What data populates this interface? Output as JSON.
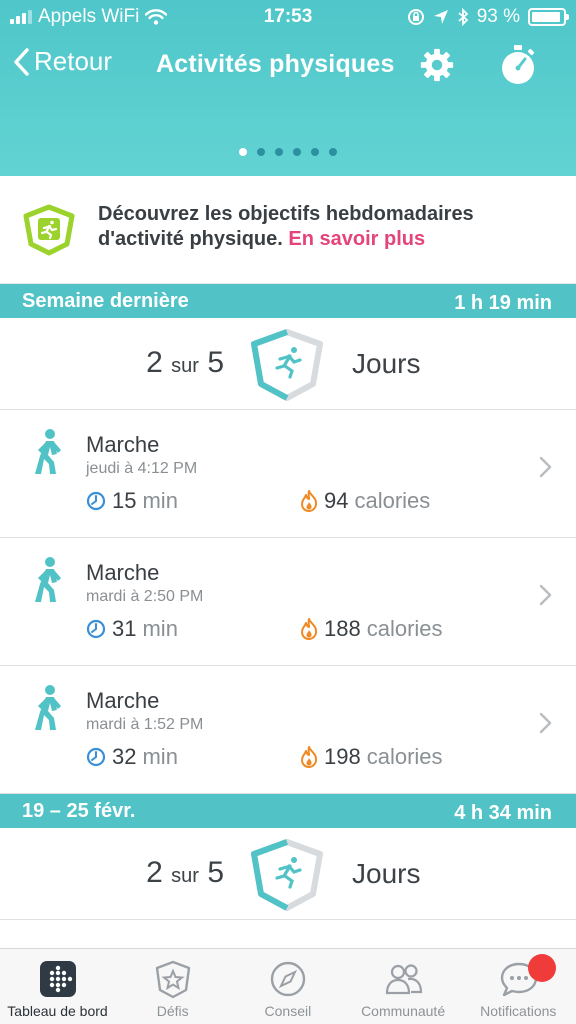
{
  "status_bar": {
    "carrier": "Appels WiFi",
    "time": "17:53",
    "battery_percent": "93 %",
    "battery_level": 0.93
  },
  "header": {
    "back_label": "Retour",
    "title": "Activités physiques",
    "page_count": 6,
    "active_page": 0
  },
  "promo": {
    "text": "Découvrez les objectifs hebdomadaires d'activité physique.",
    "link": "En savoir plus"
  },
  "weeks": [
    {
      "label": "Semaine dernière",
      "total": "1 h 19 min",
      "goal": {
        "count": "2",
        "of": "sur",
        "target": "5",
        "unit": "Jours"
      },
      "activities": [
        {
          "name": "Marche",
          "time": "jeudi à 4:12 PM",
          "duration": "15",
          "duration_unit": "min",
          "calories": "94",
          "calories_unit": "calories"
        },
        {
          "name": "Marche",
          "time": "mardi à 2:50 PM",
          "duration": "31",
          "duration_unit": "min",
          "calories": "188",
          "calories_unit": "calories"
        },
        {
          "name": "Marche",
          "time": "mardi à 1:52 PM",
          "duration": "32",
          "duration_unit": "min",
          "calories": "198",
          "calories_unit": "calories"
        }
      ]
    },
    {
      "label": "19 – 25 févr.",
      "total": "4 h 34 min",
      "goal": {
        "count": "2",
        "of": "sur",
        "target": "5",
        "unit": "Jours"
      }
    }
  ],
  "tabbar": {
    "tabs": [
      {
        "label": "Tableau de bord",
        "icon": "dashboard-icon",
        "active": true
      },
      {
        "label": "Défis",
        "icon": "challenges-star-icon",
        "active": false
      },
      {
        "label": "Conseil",
        "icon": "compass-icon",
        "active": false
      },
      {
        "label": "Communauté",
        "icon": "community-people-icon",
        "active": false
      },
      {
        "label": "Notifications",
        "icon": "chat-bubble-icon",
        "active": false
      }
    ]
  },
  "colors": {
    "teal": "#51c2c6",
    "pink_link": "#e4447a",
    "flame": "#f08a24",
    "clock": "#3a8fd6",
    "lime": "#9bd22c",
    "notification_badge": "#f03b3b"
  }
}
